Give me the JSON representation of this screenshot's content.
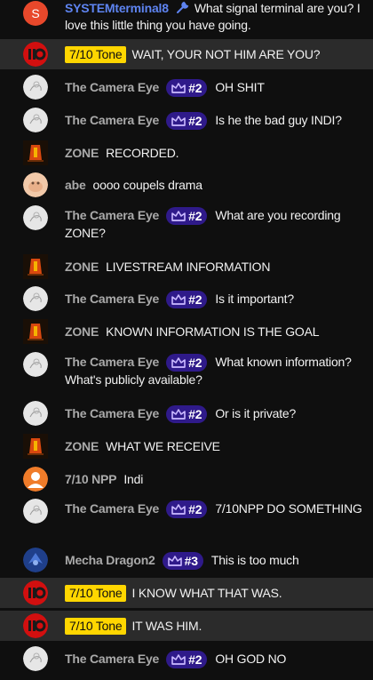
{
  "messages": [
    {
      "avatar": "letter",
      "letter": "S",
      "author": "SYSTEMterminal8",
      "author_style": "blue",
      "icon": "wrench-icon",
      "text": "What signal terminal are you? I love this little thing you have going.",
      "highlight": false
    },
    {
      "avatar": "red-logo",
      "author": "7/10 Tone",
      "author_style": "tone",
      "text": "WAIT, YOUR NOT HIM ARE YOU?",
      "highlight": true
    },
    {
      "avatar": "light",
      "author": "The Camera Eye",
      "badge": "#2",
      "text": "OH SHIT",
      "highlight": false
    },
    {
      "avatar": "light",
      "author": "The Camera Eye",
      "badge": "#2",
      "text": "Is he the bad guy INDI?",
      "highlight": false
    },
    {
      "avatar": "zone",
      "author": "ZONE",
      "text": "RECORDED.",
      "highlight": false
    },
    {
      "avatar": "abe",
      "author": "abe",
      "text": "oooo coupels drama",
      "highlight": false
    },
    {
      "avatar": "light",
      "author": "The Camera Eye",
      "badge": "#2",
      "text": "What are you recording ZONE?",
      "highlight": false
    },
    {
      "avatar": "zone",
      "author": "ZONE",
      "text": "LIVESTREAM INFORMATION",
      "highlight": false
    },
    {
      "avatar": "light",
      "author": "The Camera Eye",
      "badge": "#2",
      "text": "Is it important?",
      "highlight": false
    },
    {
      "avatar": "zone",
      "author": "ZONE",
      "text": "KNOWN INFORMATION IS THE GOAL",
      "highlight": false
    },
    {
      "avatar": "light",
      "author": "The Camera Eye",
      "badge": "#2",
      "text": "What known information? What's publicly available?",
      "highlight": false
    },
    {
      "avatar": "light",
      "author": "The Camera Eye",
      "badge": "#2",
      "text": "Or is it private?",
      "highlight": false
    },
    {
      "avatar": "zone",
      "author": "ZONE",
      "text": "WHAT WE RECEIVE",
      "highlight": false
    },
    {
      "avatar": "orange-person",
      "author": "7/10 NPP",
      "text": "Indi",
      "highlight": false
    },
    {
      "avatar": "light",
      "author": "The Camera Eye",
      "badge": "#2",
      "text": "7/10NPP DO SOMETHING",
      "highlight": false
    },
    {
      "avatar": "dragon",
      "author": "Mecha Dragon2",
      "badge": "#3",
      "text": "This is too much",
      "highlight": false
    },
    {
      "avatar": "red-logo",
      "author": "7/10 Tone",
      "author_style": "tone",
      "text": "I KNOW WHAT THAT WAS.",
      "highlight": true
    },
    {
      "avatar": "red-logo",
      "author": "7/10 Tone",
      "author_style": "tone",
      "text": "IT WAS HIM.",
      "highlight": true
    },
    {
      "avatar": "light",
      "author": "The Camera Eye",
      "badge": "#2",
      "text": "OH GOD NO",
      "highlight": false
    }
  ],
  "colors": {
    "background": "#0f0f0f",
    "highlight": "#2b2b2b",
    "author_gray": "#aaaaaa",
    "author_blue": "#5e84f1",
    "tone_badge": "#ffd600",
    "member_badge": "#2f1a8a"
  }
}
